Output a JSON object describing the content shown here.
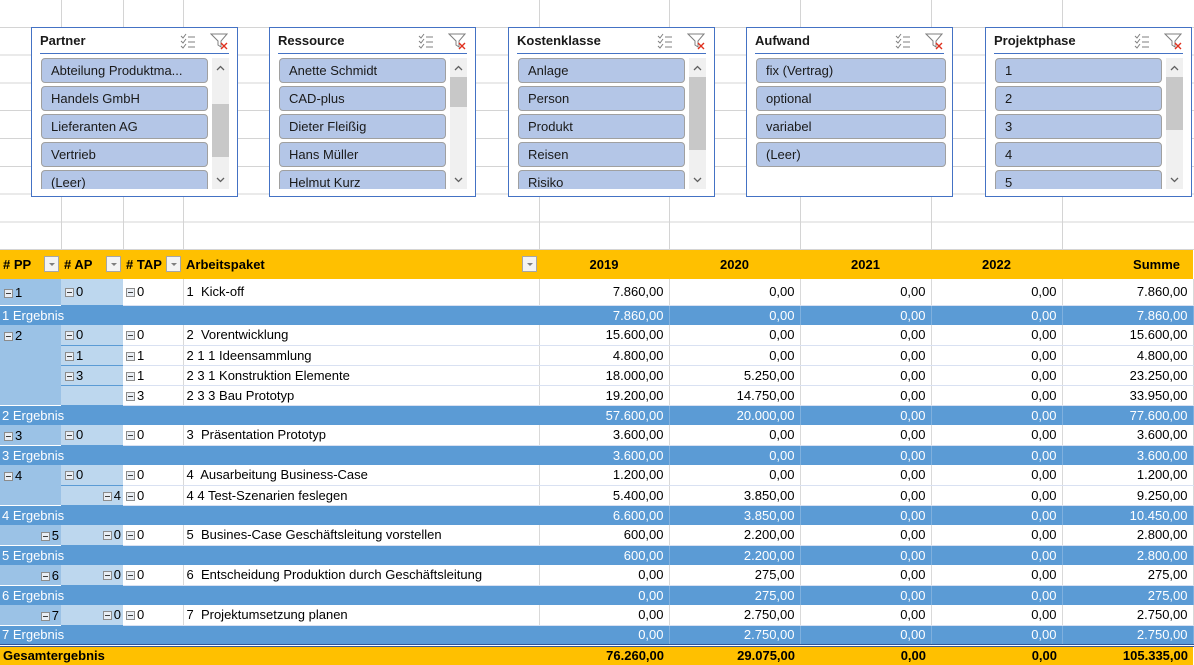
{
  "slicers": [
    {
      "title": "Partner",
      "items": [
        "Abteilung Produktma...",
        "Handels GmbH",
        "Lieferanten AG",
        "Vertrieb",
        "(Leer)"
      ],
      "scrollbar": {
        "thumb_start": 0.29,
        "thumb_size": 0.57
      }
    },
    {
      "title": "Ressource",
      "items": [
        "Anette Schmidt",
        "CAD-plus",
        "Dieter Fleißig",
        "Hans Müller",
        "Helmut Kurz"
      ],
      "scrollbar": {
        "thumb_start": 0.0,
        "thumb_size": 0.32
      }
    },
    {
      "title": "Kostenklasse",
      "items": [
        "Anlage",
        "Person",
        "Produkt",
        "Reisen",
        "Risiko"
      ],
      "scrollbar": {
        "thumb_start": 0.0,
        "thumb_size": 0.79
      }
    },
    {
      "title": "Aufwand",
      "items": [
        "fix (Vertrag)",
        "optional",
        "variabel",
        "(Leer)"
      ],
      "scrollbar": null
    },
    {
      "title": "Projektphase",
      "items": [
        "1",
        "2",
        "3",
        "4",
        "5"
      ],
      "scrollbar": {
        "thumb_start": 0.0,
        "thumb_size": 0.57
      }
    }
  ],
  "slicer_icons": {
    "multi_select": "multi-select-icon",
    "clear_filter": "clear-filter-icon"
  },
  "colors": {
    "header": "#FFC000",
    "subtotal_row": "#5B9BD5",
    "pp_column": "#9BC2E6",
    "ap_column": "#BDD7EE",
    "slicer_item": "#B4C6E7",
    "slicer_border": "#4472C4"
  },
  "table": {
    "columns": [
      "# PP",
      "# AP",
      "# TAP",
      "Arbeitspaket",
      "2019",
      "2020",
      "2021",
      "2022",
      "Summe"
    ],
    "rows": [
      {
        "type": "detail",
        "pp": "1",
        "ap": "0",
        "tap": "0",
        "name": "1  Kick-off",
        "values": [
          "7.860,00",
          "0,00",
          "0,00",
          "0,00",
          "7.860,00"
        ]
      },
      {
        "type": "subtotal",
        "label": "1 Ergebnis",
        "values": [
          "7.860,00",
          "0,00",
          "0,00",
          "0,00",
          "7.860,00"
        ]
      },
      {
        "type": "detail",
        "pp": "2",
        "ap": "0",
        "tap": "0",
        "name": "2  Vorentwicklung",
        "values": [
          "15.600,00",
          "0,00",
          "0,00",
          "0,00",
          "15.600,00"
        ]
      },
      {
        "type": "detail",
        "pp": "",
        "ap": "1",
        "tap": "1",
        "name": "2 1 1 Ideensammlung",
        "values": [
          "4.800,00",
          "0,00",
          "0,00",
          "0,00",
          "4.800,00"
        ]
      },
      {
        "type": "detail",
        "pp": "",
        "ap": "3",
        "tap": "1",
        "name": "2 3 1 Konstruktion Elemente",
        "values": [
          "18.000,00",
          "5.250,00",
          "0,00",
          "0,00",
          "23.250,00"
        ]
      },
      {
        "type": "detail",
        "pp": "",
        "ap": "",
        "tap": "3",
        "name": "2 3 3 Bau Prototyp",
        "values": [
          "19.200,00",
          "14.750,00",
          "0,00",
          "0,00",
          "33.950,00"
        ]
      },
      {
        "type": "subtotal",
        "label": "2 Ergebnis",
        "values": [
          "57.600,00",
          "20.000,00",
          "0,00",
          "0,00",
          "77.600,00"
        ]
      },
      {
        "type": "detail",
        "pp": "3",
        "ap": "0",
        "tap": "0",
        "name": "3  Präsentation Prototyp",
        "values": [
          "3.600,00",
          "0,00",
          "0,00",
          "0,00",
          "3.600,00"
        ]
      },
      {
        "type": "subtotal",
        "label": "3 Ergebnis",
        "values": [
          "3.600,00",
          "0,00",
          "0,00",
          "0,00",
          "3.600,00"
        ]
      },
      {
        "type": "detail",
        "pp": "4",
        "ap": "0",
        "tap": "0",
        "name": "4  Ausarbeitung Business-Case",
        "values": [
          "1.200,00",
          "0,00",
          "0,00",
          "0,00",
          "1.200,00"
        ]
      },
      {
        "type": "detail",
        "pp": "",
        "ap": "4",
        "tap": "0",
        "name": "4 4 Test-Szenarien feslegen",
        "values": [
          "5.400,00",
          "3.850,00",
          "0,00",
          "0,00",
          "9.250,00"
        ]
      },
      {
        "type": "subtotal",
        "label": "4 Ergebnis",
        "values": [
          "6.600,00",
          "3.850,00",
          "0,00",
          "0,00",
          "10.450,00"
        ]
      },
      {
        "type": "detail",
        "pp": "5",
        "ap": "0",
        "tap": "0",
        "name": "5  Busines-Case Geschäftsleitung vorstellen",
        "values": [
          "600,00",
          "2.200,00",
          "0,00",
          "0,00",
          "2.800,00"
        ]
      },
      {
        "type": "subtotal",
        "label": "5 Ergebnis",
        "values": [
          "600,00",
          "2.200,00",
          "0,00",
          "0,00",
          "2.800,00"
        ]
      },
      {
        "type": "detail",
        "pp": "6",
        "ap": "0",
        "tap": "0",
        "name": "6  Entscheidung Produktion durch Geschäftsleitung",
        "values": [
          "0,00",
          "275,00",
          "0,00",
          "0,00",
          "275,00"
        ]
      },
      {
        "type": "subtotal",
        "label": "6 Ergebnis",
        "values": [
          "0,00",
          "275,00",
          "0,00",
          "0,00",
          "275,00"
        ]
      },
      {
        "type": "detail",
        "pp": "7",
        "ap": "0",
        "tap": "0",
        "name": "7  Projektumsetzung planen",
        "values": [
          "0,00",
          "2.750,00",
          "0,00",
          "0,00",
          "2.750,00"
        ]
      },
      {
        "type": "subtotal",
        "label": "7 Ergebnis",
        "values": [
          "0,00",
          "2.750,00",
          "0,00",
          "0,00",
          "2.750,00"
        ]
      }
    ],
    "grand_total": {
      "label": "Gesamtergebnis",
      "values": [
        "76.260,00",
        "29.075,00",
        "0,00",
        "0,00",
        "105.335,00"
      ]
    }
  }
}
